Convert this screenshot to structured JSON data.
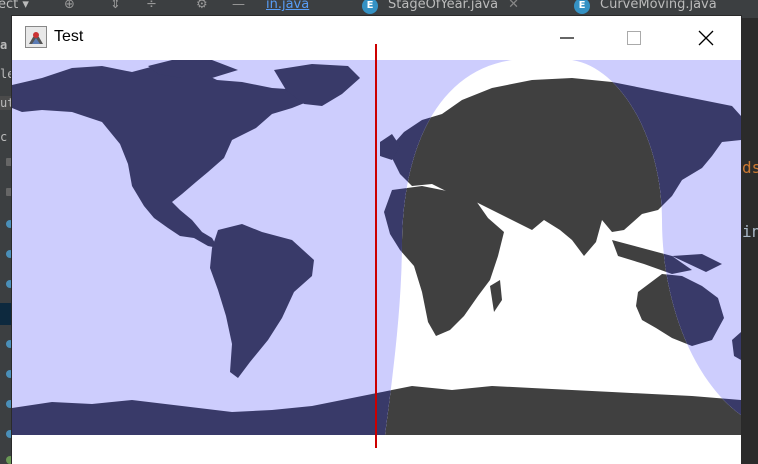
{
  "ide": {
    "tabs": [
      {
        "label": "ect",
        "active": false
      },
      {
        "label": "in.java",
        "active": true
      },
      {
        "label": "StageOfYear.java",
        "active": false
      },
      {
        "label": "CurveMoving.java",
        "active": false
      }
    ],
    "left_gutter_fragments": [
      "a",
      "le",
      "ut",
      "c"
    ],
    "right_code_fragments": [
      "ds",
      "in"
    ],
    "file_badge": "E"
  },
  "window": {
    "title": "Test",
    "buttons": {
      "minimize": "minimize",
      "maximize": "maximize",
      "close": "close"
    }
  },
  "map": {
    "day_color": "#ffffff",
    "night_color": "#cdcdfd",
    "land_day_color": "#404040",
    "land_night_color": "#393a69",
    "meridian_color": "#cc0000"
  }
}
